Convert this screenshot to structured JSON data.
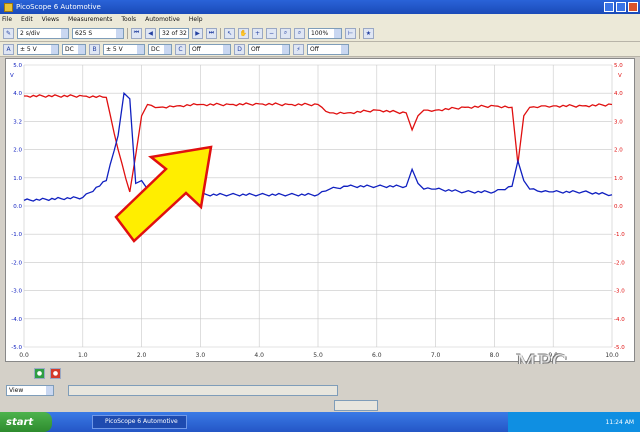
{
  "window": {
    "title": "PicoScope 6 Automotive"
  },
  "menu": [
    "File",
    "Edit",
    "Views",
    "Measurements",
    "Tools",
    "Automotive",
    "Help"
  ],
  "toolbar1": {
    "scale": "2 s/div",
    "samples": "625 S",
    "capture_count": "32 of 32",
    "zoom": "100%"
  },
  "toolbar2": {
    "channel_a_range": "± 5 V",
    "channel_a_coupling": "DC",
    "channel_b_range": "± 5 V",
    "channel_b_coupling": "DC",
    "channel_c": "Off",
    "channel_d": "Off",
    "trigger": "Off"
  },
  "chart_data": {
    "type": "line",
    "xlim": [
      0,
      10
    ],
    "ylim": [
      -5,
      5
    ],
    "x_ticks": [
      "0.0",
      "1.0",
      "2.0",
      "3.0",
      "4.0",
      "5.0",
      "6.0",
      "7.0",
      "8.0",
      "9.0",
      "10.0"
    ],
    "y_ticks_left": [
      "5.0",
      "4.0",
      "3.2",
      "2.0",
      "1.0",
      "0.0",
      "-1.0",
      "-2.0",
      "-3.0",
      "-4.0",
      "-5.0"
    ],
    "y_ticks_right": [
      "5.0",
      "4.0",
      "3.0",
      "2.0",
      "1.0",
      "0.0",
      "-1.0",
      "-2.0",
      "-3.0",
      "-4.0",
      "-5.0"
    ],
    "y_unit_left": "V",
    "y_unit_right": "V",
    "grid": true,
    "series": [
      {
        "color": "#e01010",
        "x": [
          0,
          1.0,
          1.4,
          1.6,
          1.8,
          1.9,
          2.0,
          2.1,
          2.3,
          2.6,
          3.0,
          3.5,
          4.0,
          4.5,
          5.0,
          5.2,
          5.5,
          6.0,
          6.5,
          6.6,
          6.7,
          6.8,
          7.0,
          7.5,
          8.0,
          8.3,
          8.4,
          8.5,
          8.6,
          8.8,
          9.0,
          9.5,
          10.0
        ],
        "y": [
          3.9,
          3.9,
          3.85,
          2.0,
          0.5,
          1.8,
          3.2,
          3.6,
          3.5,
          3.55,
          3.6,
          3.6,
          3.62,
          3.6,
          3.6,
          3.3,
          3.3,
          3.4,
          3.3,
          2.7,
          3.2,
          3.4,
          3.4,
          3.5,
          3.55,
          3.5,
          1.5,
          3.2,
          3.5,
          3.55,
          3.55,
          3.55,
          3.6
        ]
      },
      {
        "color": "#1020c0",
        "x": [
          0,
          1.0,
          1.4,
          1.6,
          1.7,
          1.8,
          1.9,
          2.0,
          2.1,
          2.3,
          2.6,
          3.0,
          3.5,
          4.0,
          4.5,
          5.0,
          5.2,
          5.5,
          6.0,
          6.5,
          6.6,
          6.7,
          6.8,
          7.0,
          7.5,
          8.0,
          8.3,
          8.4,
          8.5,
          8.6,
          8.8,
          9.0,
          9.5,
          10.0
        ],
        "y": [
          0.2,
          0.3,
          0.9,
          2.5,
          4.0,
          3.8,
          0.8,
          0.9,
          0.6,
          0.5,
          0.5,
          0.4,
          0.4,
          0.4,
          0.4,
          0.4,
          0.6,
          0.7,
          0.7,
          0.7,
          1.3,
          0.8,
          0.6,
          0.6,
          0.5,
          0.5,
          0.7,
          1.6,
          0.9,
          0.6,
          0.5,
          0.5,
          0.5,
          0.4
        ]
      }
    ]
  },
  "overlay": {
    "arrow_color": "#ffee00",
    "arrow_outline": "#e01010",
    "watermark": "MPC"
  },
  "bottom": {
    "view_label": "View"
  },
  "taskbar": {
    "start": "start",
    "task": "PicoScope 6 Automotive",
    "clock": "11:24 AM"
  }
}
